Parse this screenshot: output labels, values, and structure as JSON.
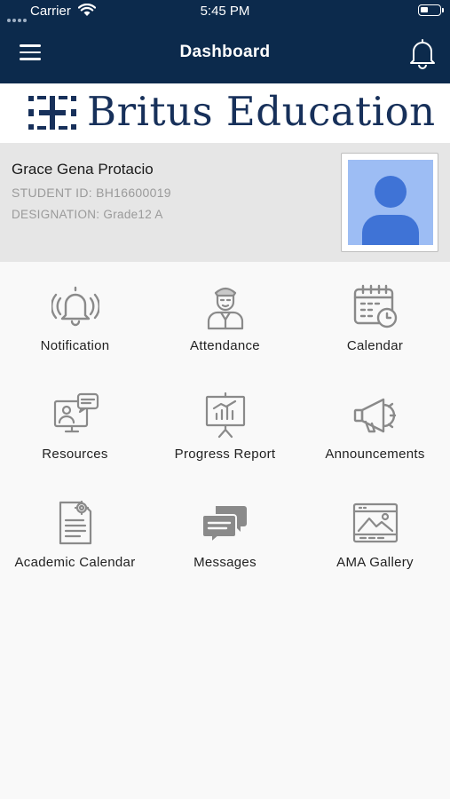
{
  "status_bar": {
    "carrier": "Carrier",
    "time": "5:45 PM"
  },
  "header": {
    "title": "Dashboard",
    "menu_icon": "hamburger-menu-icon",
    "notification_icon": "bell-icon",
    "background": "#0c2a4c"
  },
  "brand": {
    "name": "Britus Education",
    "color": "#17305a"
  },
  "profile": {
    "name": "Grace Gena Protacio",
    "student_id": "STUDENT ID: BH16600019",
    "designation": "DESIGNATION: Grade12 A",
    "avatar_icon": "person-avatar-icon"
  },
  "menu": [
    {
      "label": "Notification",
      "icon": "bell-icon"
    },
    {
      "label": "Attendance",
      "icon": "student-icon"
    },
    {
      "label": "Calendar",
      "icon": "calendar-clock-icon"
    },
    {
      "label": "Resources",
      "icon": "online-learning-icon"
    },
    {
      "label": "Progress Report",
      "icon": "presentation-chart-icon"
    },
    {
      "label": "Announcements",
      "icon": "megaphone-icon"
    },
    {
      "label": "Academic Calendar",
      "icon": "document-gear-icon"
    },
    {
      "label": "Messages",
      "icon": "chat-bubbles-icon"
    },
    {
      "label": "AMA Gallery",
      "icon": "image-gallery-icon"
    }
  ]
}
